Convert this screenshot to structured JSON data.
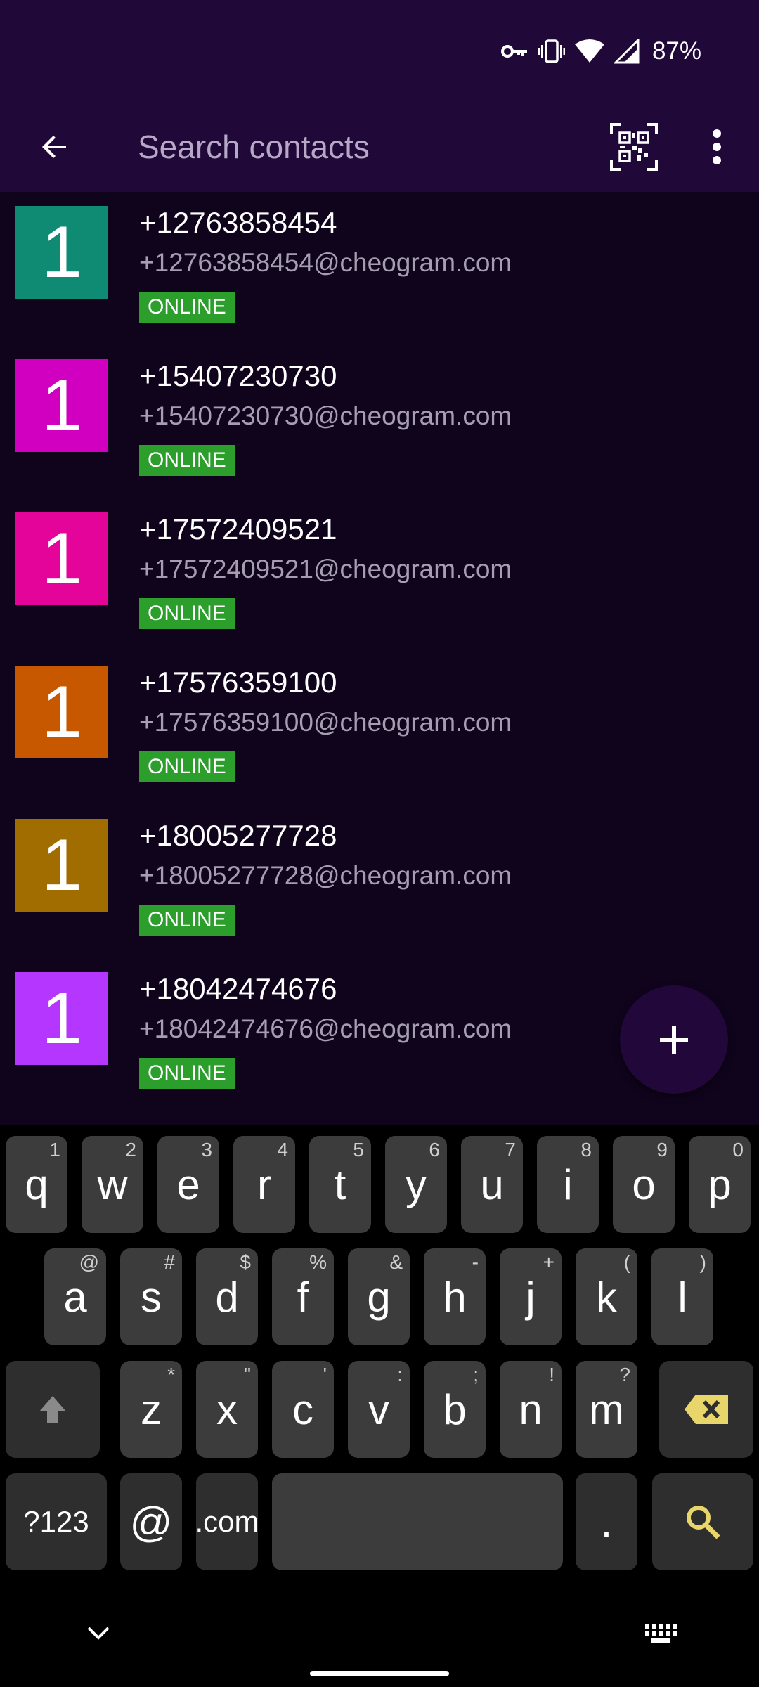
{
  "status_bar": {
    "battery": "87%",
    "icons": [
      "vpn-key-icon",
      "vibrate-icon",
      "wifi-icon",
      "signal-icon"
    ]
  },
  "toolbar": {
    "search_placeholder": "Search contacts",
    "icons": [
      "back-arrow-icon",
      "qr-code-icon",
      "more-vert-icon"
    ]
  },
  "contacts": [
    {
      "initial": "1",
      "name": "+12763858454",
      "jid": "+12763858454@cheogram.com",
      "status": "ONLINE",
      "color": "#0f8a73"
    },
    {
      "initial": "1",
      "name": "+15407230730",
      "jid": "+15407230730@cheogram.com",
      "status": "ONLINE",
      "color": "#d100c0"
    },
    {
      "initial": "1",
      "name": "+17572409521",
      "jid": "+17572409521@cheogram.com",
      "status": "ONLINE",
      "color": "#e5049a"
    },
    {
      "initial": "1",
      "name": "+17576359100",
      "jid": "+17576359100@cheogram.com",
      "status": "ONLINE",
      "color": "#c75800"
    },
    {
      "initial": "1",
      "name": "+18005277728",
      "jid": "+18005277728@cheogram.com",
      "status": "ONLINE",
      "color": "#a26d00"
    },
    {
      "initial": "1",
      "name": "+18042474676",
      "jid": "+18042474676@cheogram.com",
      "status": "ONLINE",
      "color": "#b536ff"
    }
  ],
  "fab": {
    "icon": "plus-icon"
  },
  "keyboard": {
    "row1": [
      {
        "k": "q",
        "h": "1"
      },
      {
        "k": "w",
        "h": "2"
      },
      {
        "k": "e",
        "h": "3"
      },
      {
        "k": "r",
        "h": "4"
      },
      {
        "k": "t",
        "h": "5"
      },
      {
        "k": "y",
        "h": "6"
      },
      {
        "k": "u",
        "h": "7"
      },
      {
        "k": "i",
        "h": "8"
      },
      {
        "k": "o",
        "h": "9"
      },
      {
        "k": "p",
        "h": "0"
      }
    ],
    "row2": [
      {
        "k": "a",
        "h": "@"
      },
      {
        "k": "s",
        "h": "#"
      },
      {
        "k": "d",
        "h": "$"
      },
      {
        "k": "f",
        "h": "%"
      },
      {
        "k": "g",
        "h": "&"
      },
      {
        "k": "h",
        "h": "-"
      },
      {
        "k": "j",
        "h": "+"
      },
      {
        "k": "k",
        "h": "("
      },
      {
        "k": "l",
        "h": ")"
      }
    ],
    "row3": [
      {
        "k": "z",
        "h": "*"
      },
      {
        "k": "x",
        "h": "\""
      },
      {
        "k": "c",
        "h": "'"
      },
      {
        "k": "v",
        "h": ":"
      },
      {
        "k": "b",
        "h": ";"
      },
      {
        "k": "n",
        "h": "!"
      },
      {
        "k": "m",
        "h": "?"
      }
    ],
    "symbols_label": "?123",
    "at_label": "@",
    "dotcom_label": ".com",
    "period_label": ".",
    "accent_color": "#e8d66a"
  }
}
